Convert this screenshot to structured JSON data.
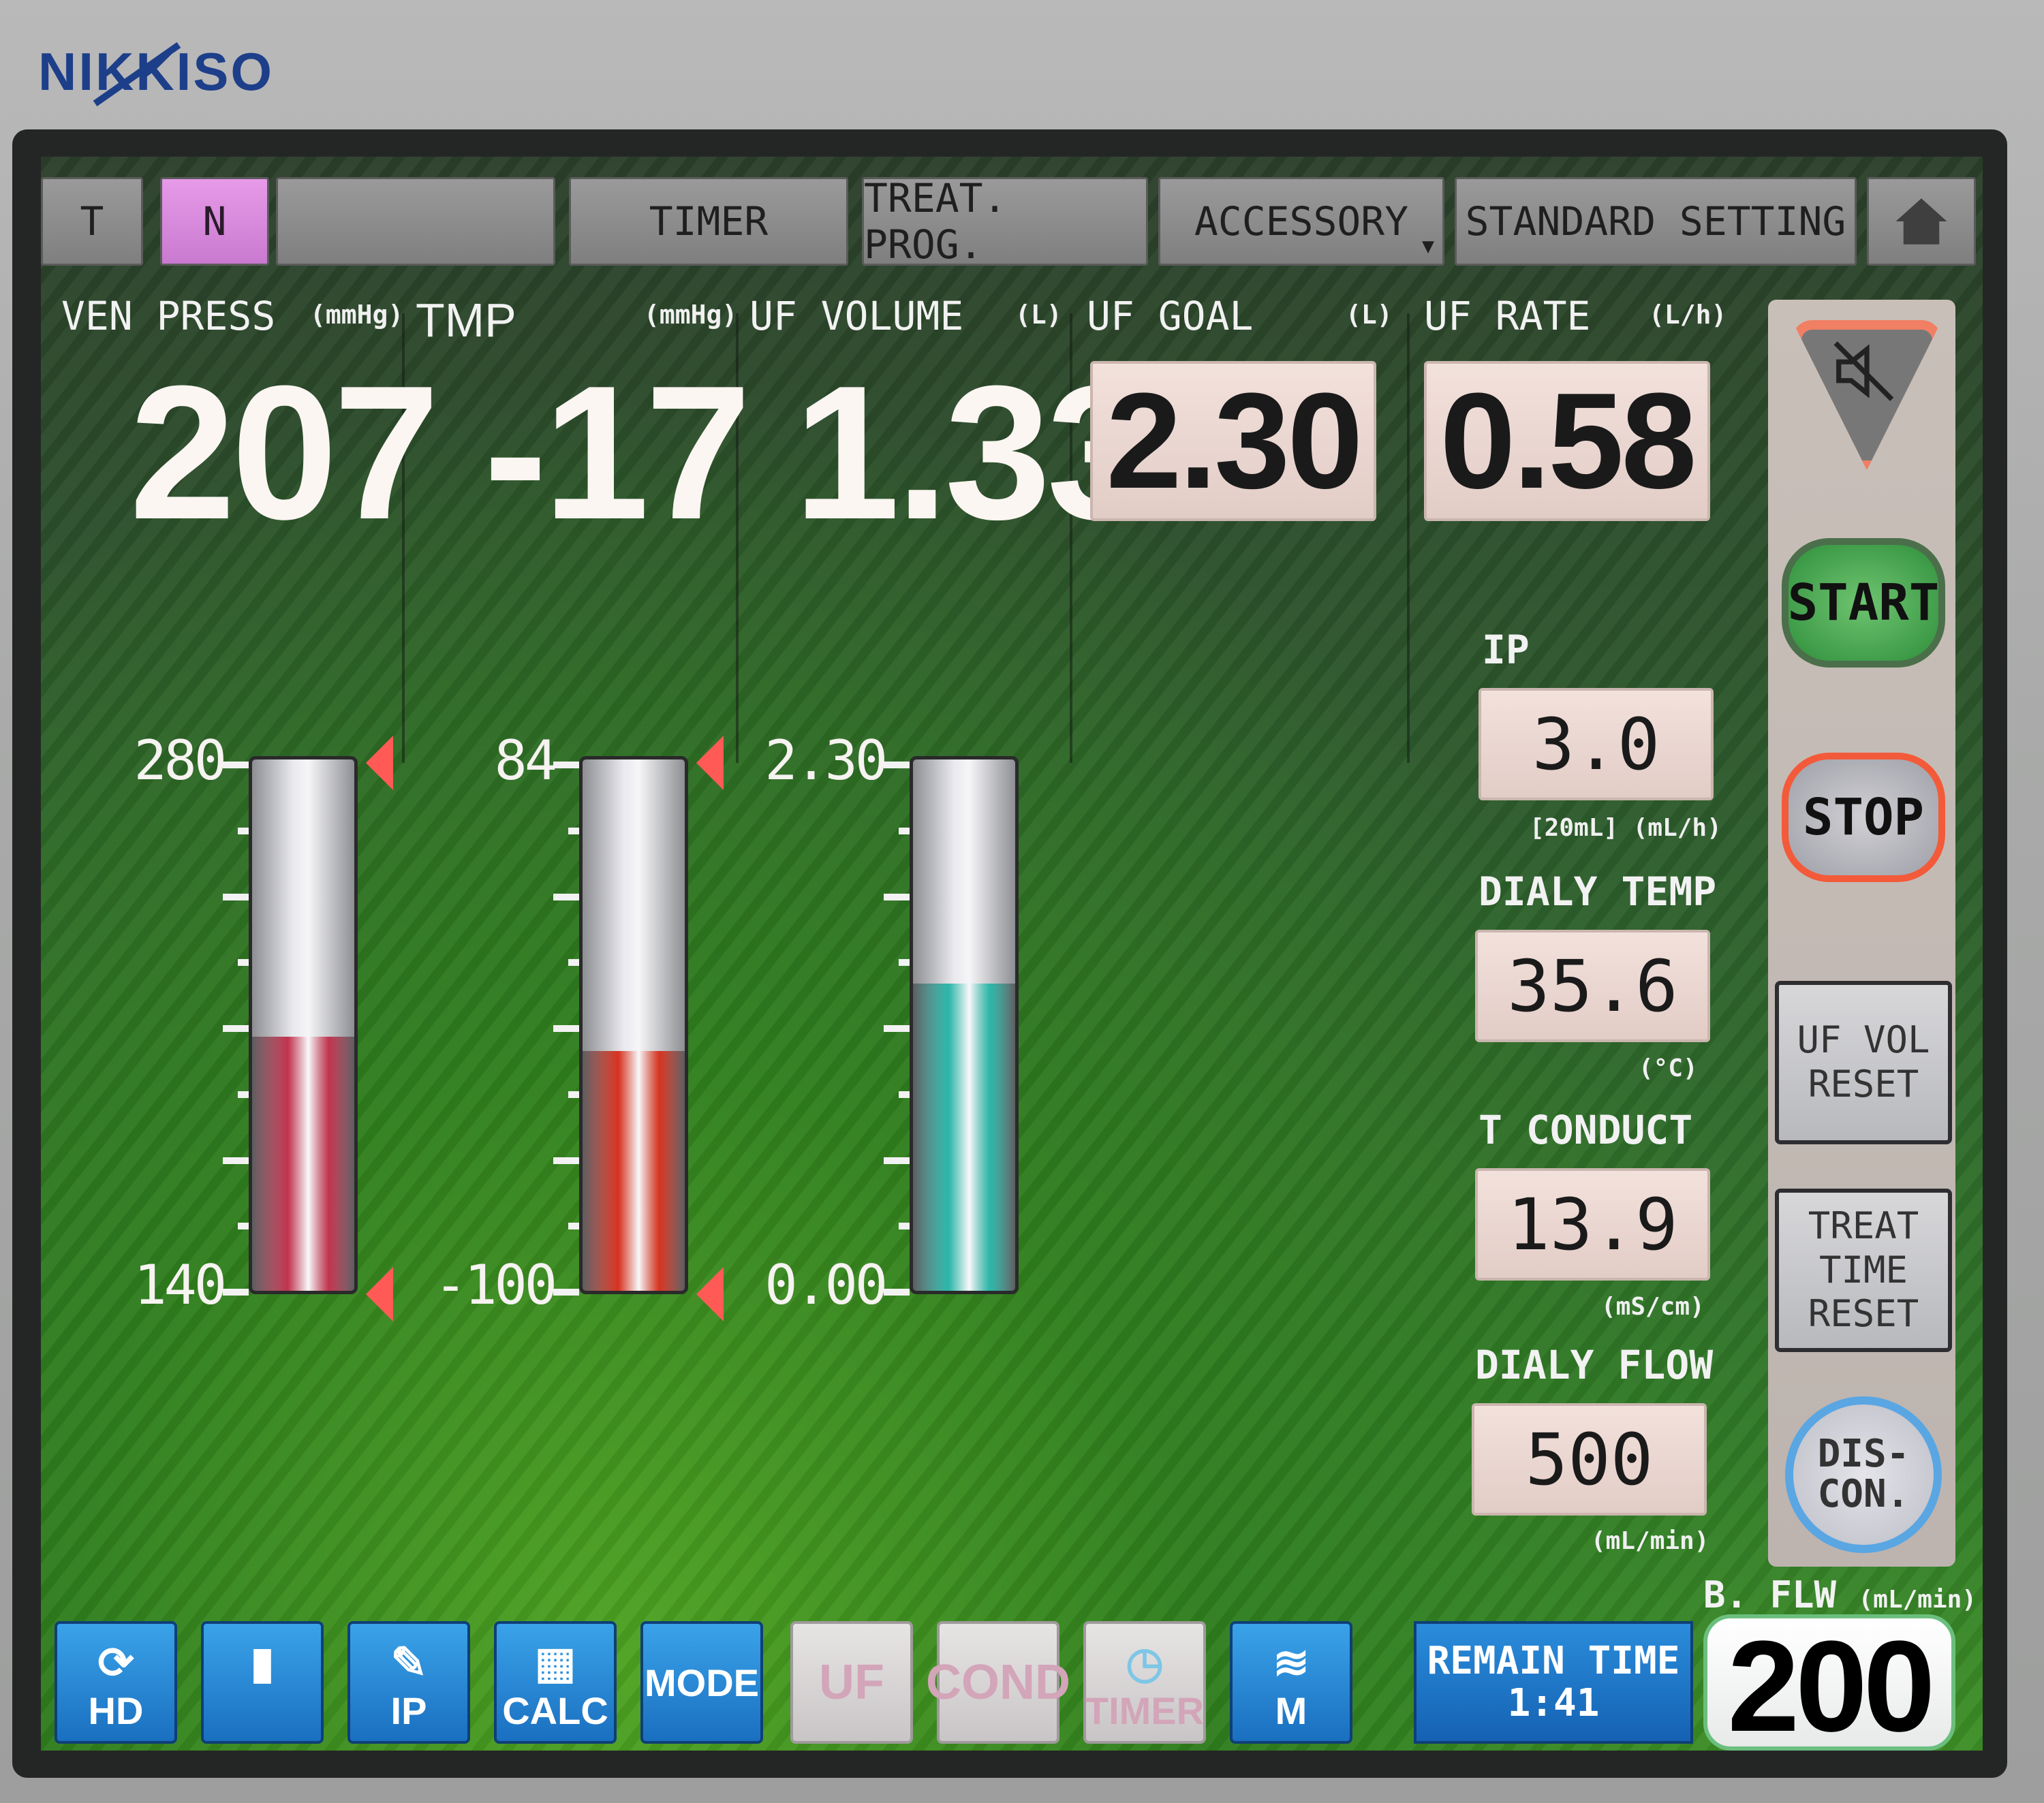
{
  "brand": "NIKKISO",
  "tabs": [
    {
      "label": "T",
      "active": false
    },
    {
      "label": "N",
      "active": true
    },
    {
      "label": "",
      "active": false
    },
    {
      "label": "TIMER",
      "active": false
    },
    {
      "label": "TREAT. PROG.",
      "active": false
    },
    {
      "label": "ACCESSORY",
      "active": false
    },
    {
      "label": "STANDARD SETTING",
      "active": false
    }
  ],
  "home_icon": "home-icon",
  "readouts": {
    "ven_press": {
      "label": "VEN PRESS",
      "unit": "(mmHg)",
      "value": "207"
    },
    "tmp": {
      "label": "TMP",
      "unit": "(mmHg)",
      "value": "-17"
    },
    "uf_volume": {
      "label": "UF VOLUME",
      "unit": "(L)",
      "value": "1.33"
    },
    "uf_goal": {
      "label": "UF GOAL",
      "unit": "(L)",
      "value": "2.30"
    },
    "uf_rate": {
      "label": "UF RATE",
      "unit": "(L/h)",
      "value": "0.58"
    }
  },
  "gauges": [
    {
      "name": "ven-press",
      "top_label": "280",
      "bottom_label": "140",
      "min": 140,
      "max": 280,
      "value": 207,
      "color": "#c2334e",
      "alarm_marks": true
    },
    {
      "name": "tmp",
      "top_label": "84",
      "bottom_label": "-100",
      "min": -100,
      "max": 84,
      "value": -17,
      "color": "#d8321f",
      "alarm_marks": true
    },
    {
      "name": "uf-volume",
      "top_label": "2.30",
      "bottom_label": "0.00",
      "min": 0,
      "max": 2.3,
      "value": 1.33,
      "color": "#2bb7a9",
      "alarm_marks": false
    }
  ],
  "settings": {
    "ip": {
      "label": "IP",
      "value": "3.0",
      "note": "[20mL] (mL/h)"
    },
    "dialy_temp": {
      "label": "DIALY TEMP",
      "value": "35.6",
      "unit": "(°C)"
    },
    "t_conduct": {
      "label": "T CONDUCT",
      "value": "13.9",
      "unit": "(mS/cm)"
    },
    "dialy_flow": {
      "label": "DIALY FLOW",
      "value": "500",
      "unit": "(mL/min)"
    }
  },
  "side_buttons": {
    "mute": "mute-icon",
    "start": "START",
    "stop": "STOP",
    "uf_vol_reset": "UF VOL RESET",
    "treat_time_reset": "TREAT TIME RESET",
    "discon": "DIS- CON."
  },
  "bottom_bar": [
    {
      "label": "HD",
      "icon": "hd-cycle-icon",
      "dim": false
    },
    {
      "label": "",
      "icon": "dialyzer-icon",
      "dim": false
    },
    {
      "label": "IP",
      "icon": "syringe-icon",
      "dim": false
    },
    {
      "label": "CALC",
      "icon": "calculator-icon",
      "dim": false
    },
    {
      "label": "MODE",
      "icon": "",
      "dim": false
    },
    {
      "label": "UF",
      "icon": "",
      "dim": true
    },
    {
      "label": "COND",
      "icon": "",
      "dim": true
    },
    {
      "label": "TIMER",
      "icon": "clock-icon",
      "dim": true
    },
    {
      "label": "M",
      "icon": "memo-icon",
      "dim": false
    }
  ],
  "remain_time": {
    "label": "REMAIN TIME",
    "value": "1:41"
  },
  "b_flow": {
    "label": "B. FLW",
    "unit": "(mL/min)",
    "value": "200"
  }
}
